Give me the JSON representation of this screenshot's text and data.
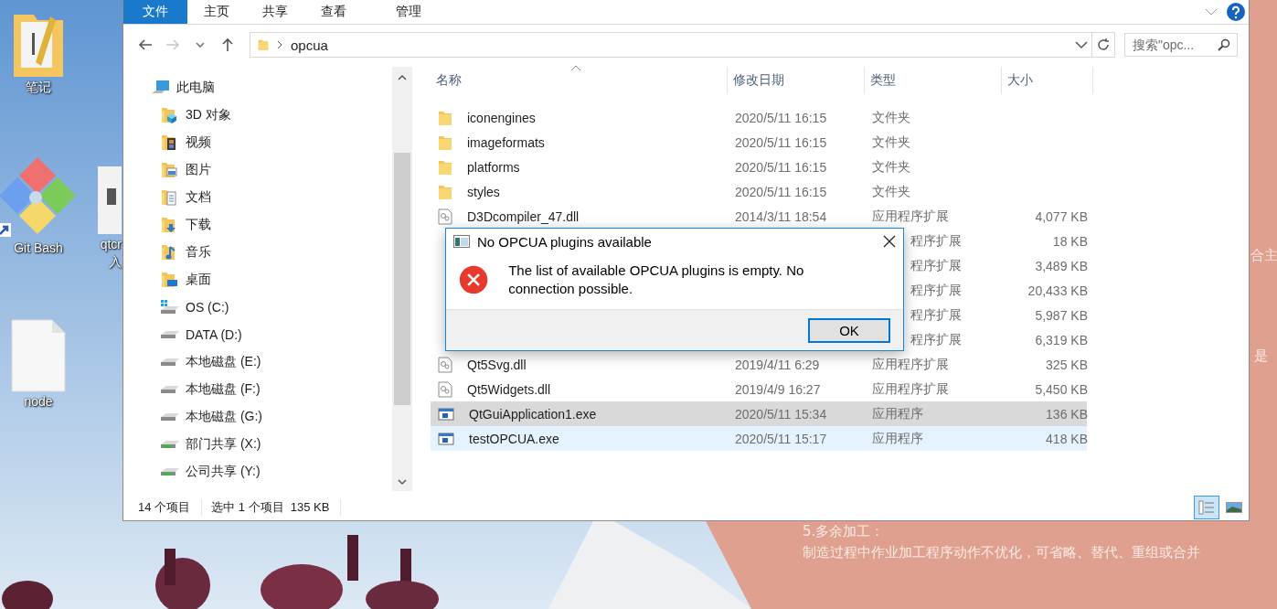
{
  "desktop": {
    "icons": [
      {
        "kind": "notes",
        "label_lines": [
          "笔记"
        ]
      },
      {
        "kind": "git",
        "label_lines": [
          "Git Bash"
        ]
      },
      {
        "kind": "app",
        "label_lines": [
          "qtcr",
          "入"
        ]
      },
      {
        "kind": "file",
        "label_lines": [
          "node"
        ]
      }
    ],
    "texts": [
      "合主",
      "是",
      "5.多余加工：",
      "制造过程中作业加工程序动作不优化，可省略、替代、重组或合并"
    ]
  },
  "window": {
    "ribbon_tabs": [
      {
        "label": "文件",
        "selected": true
      },
      {
        "label": "主页",
        "selected": false
      },
      {
        "label": "共享",
        "selected": false
      },
      {
        "label": "查看",
        "selected": false
      },
      {
        "label": "管理",
        "selected": false
      }
    ],
    "address": {
      "folder": "opcua"
    },
    "search": {
      "placeholder": "搜索\"opc..."
    },
    "nav": {
      "items": [
        {
          "label": "此电脑",
          "kind": "pc",
          "children": [
            {
              "label": "3D 对象",
              "kind": "objects3d"
            },
            {
              "label": "视频",
              "kind": "video"
            },
            {
              "label": "图片",
              "kind": "pictures"
            },
            {
              "label": "文档",
              "kind": "documents"
            },
            {
              "label": "下载",
              "kind": "downloads"
            },
            {
              "label": "音乐",
              "kind": "music"
            },
            {
              "label": "桌面",
              "kind": "desktop"
            },
            {
              "label": "OS (C:)",
              "kind": "system"
            },
            {
              "label": "DATA (D:)",
              "kind": "drive"
            },
            {
              "label": "本地磁盘 (E:)",
              "kind": "drive"
            },
            {
              "label": "本地磁盘 (F:)",
              "kind": "drive"
            },
            {
              "label": "本地磁盘 (G:)",
              "kind": "drive"
            },
            {
              "label": "部门共享 (X:)",
              "kind": "network"
            },
            {
              "label": "公司共享 (Y:)",
              "kind": "network"
            }
          ]
        }
      ]
    },
    "columns": [
      {
        "label": "名称",
        "sorted": true
      },
      {
        "label": "修改日期",
        "sorted": false
      },
      {
        "label": "类型",
        "sorted": false
      },
      {
        "label": "大小",
        "sorted": false
      }
    ],
    "rows": [
      {
        "kind": "folder",
        "name": "iconengines",
        "date": "2020/5/11 16:15",
        "type": "文件夹",
        "selected": false,
        "hovered": false
      },
      {
        "kind": "folder",
        "name": "imageformats",
        "date": "2020/5/11 16:15",
        "type": "文件夹",
        "selected": false,
        "hovered": false
      },
      {
        "kind": "folder",
        "name": "platforms",
        "date": "2020/5/11 16:15",
        "type": "文件夹",
        "selected": false,
        "hovered": false
      },
      {
        "kind": "folder",
        "name": "styles",
        "date": "2020/5/11 16:15",
        "type": "文件夹",
        "selected": false,
        "hovered": false
      },
      {
        "kind": "dll",
        "name": "D3Dcompiler_47.dll",
        "date": "2014/3/11 18:54",
        "type": "应用程序扩展",
        "size": "4,077 KB",
        "selected": false,
        "hovered": false
      },
      {
        "kind": "covered",
        "type": "程序扩展",
        "size": "18 KB",
        "selected": false,
        "hovered": false
      },
      {
        "kind": "covered",
        "type": "程序扩展",
        "size": "3,489 KB",
        "selected": false,
        "hovered": false
      },
      {
        "kind": "covered",
        "type": "程序扩展",
        "size": "20,433 KB",
        "selected": false,
        "hovered": false
      },
      {
        "kind": "covered",
        "type": "程序扩展",
        "size": "5,987 KB",
        "selected": false,
        "hovered": false
      },
      {
        "kind": "covered",
        "type": "程序扩展",
        "size": "6,319 KB",
        "selected": false,
        "hovered": false
      },
      {
        "kind": "dll",
        "name": "Qt5Svg.dll",
        "date": "2019/4/11 6:29",
        "type": "应用程序扩展",
        "size": "325 KB",
        "selected": false,
        "hovered": false
      },
      {
        "kind": "dll",
        "name": "Qt5Widgets.dll",
        "date": "2019/4/9 16:27",
        "type": "应用程序扩展",
        "size": "5,450 KB",
        "selected": false,
        "hovered": false
      },
      {
        "kind": "exe",
        "name": "QtGuiApplication1.exe",
        "date": "2020/5/11 15:34",
        "type": "应用程序",
        "size": "136 KB",
        "selected": true,
        "hovered": false
      },
      {
        "kind": "exe",
        "name": "testOPCUA.exe",
        "date": "2020/5/11 15:17",
        "type": "应用程序",
        "size": "418 KB",
        "selected": false,
        "hovered": true
      }
    ],
    "status_bar": {
      "item_count": "14 个项目",
      "selection": "选中 1 个项目",
      "selection_size": "135 KB"
    },
    "view_buttons": [
      {
        "kind": "details",
        "selected": true
      },
      {
        "kind": "thumbnails",
        "selected": false
      }
    ]
  },
  "dialog": {
    "title": "No OPCUA plugins available",
    "kind": "error",
    "message": "The list of available OPCUA plugins is empty. No connection possible.",
    "buttons": [
      {
        "label": "OK",
        "default": true
      }
    ]
  }
}
